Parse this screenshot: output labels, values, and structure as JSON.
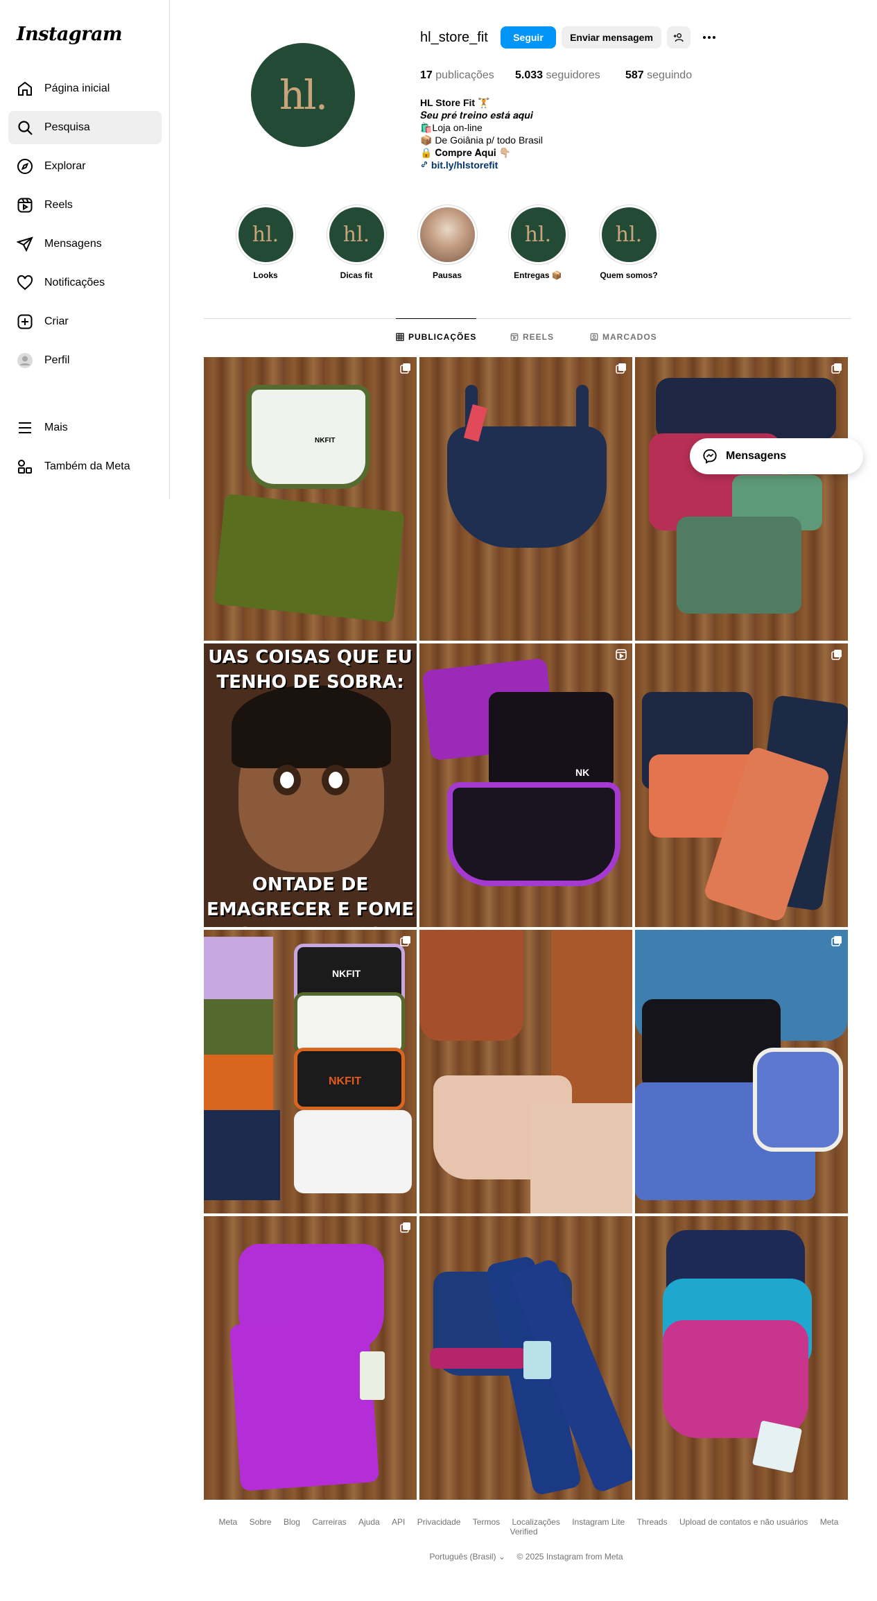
{
  "app": {
    "logo": "Instagram"
  },
  "sidebar": {
    "items": [
      {
        "label": "Página inicial",
        "icon": "home-icon"
      },
      {
        "label": "Pesquisa",
        "icon": "search-icon",
        "active": true
      },
      {
        "label": "Explorar",
        "icon": "compass-icon"
      },
      {
        "label": "Reels",
        "icon": "reels-icon"
      },
      {
        "label": "Mensagens",
        "icon": "send-icon"
      },
      {
        "label": "Notificações",
        "icon": "heart-icon"
      },
      {
        "label": "Criar",
        "icon": "plus-square-icon"
      },
      {
        "label": "Perfil",
        "icon": "profile-avatar-icon"
      },
      {
        "label": "Mais",
        "icon": "menu-icon"
      },
      {
        "label": "Também da Meta",
        "icon": "meta-apps-icon"
      }
    ]
  },
  "profile": {
    "avatar_text": "hl.",
    "username": "hl_store_fit",
    "follow_label": "Seguir",
    "message_label": "Enviar mensagem",
    "stats": {
      "posts_count": "17",
      "posts_label": "publicações",
      "followers_count": "5.033",
      "followers_label": "seguidores",
      "following_count": "587",
      "following_label": "seguindo"
    },
    "bio": {
      "name": "HL Store Fit 🏋️",
      "line1": "𝑺𝒆𝒖 𝒑𝒓𝒆́ 𝒕𝒓𝒆𝒊𝒏𝒐 𝒆𝒔𝒕𝒂́ 𝒂𝒒𝒖𝒊",
      "line2": "🛍️Loja on-line",
      "line3": "📦 De Goiânia p/ todo Brasil",
      "line4": "🔒 𝐂𝐨𝐦𝐩𝐫𝐞 𝐀𝐪𝐮𝐢 👇🏼",
      "link": "bit.ly/hlstorefit"
    }
  },
  "highlights": [
    {
      "label": "Looks",
      "thumb": "hl."
    },
    {
      "label": "Dicas fit",
      "thumb": "hl."
    },
    {
      "label": "Pausas",
      "thumb": ""
    },
    {
      "label": "Entregas 📦",
      "thumb": "hl."
    },
    {
      "label": "Quem somos?",
      "thumb": "hl."
    }
  ],
  "tabs": [
    {
      "label": "PUBLICAÇÕES",
      "icon": "grid-icon",
      "active": true
    },
    {
      "label": "REELS",
      "icon": "reels-icon"
    },
    {
      "label": "MARCADOS",
      "icon": "tagged-icon"
    }
  ],
  "posts": [
    {
      "desc": "white-green-set",
      "badge": "carousel-icon"
    },
    {
      "desc": "navy-bra",
      "badge": "carousel-icon"
    },
    {
      "desc": "green-pink-set",
      "badge": "carousel-icon"
    },
    {
      "desc": "meme",
      "badge": "",
      "meme_top": "UAS COISAS QUE EU TENHO DE SOBRA:",
      "meme_bottom": "ONTADE DE EMAGRECER E FOME O DIA INTEIRO"
    },
    {
      "desc": "purple-black-set",
      "badge": "reel-icon"
    },
    {
      "desc": "orange-navy-set",
      "badge": "carousel-icon"
    },
    {
      "desc": "multi-color-sets",
      "badge": "carousel-icon"
    },
    {
      "desc": "rust-beige-set",
      "badge": ""
    },
    {
      "desc": "blue-sets",
      "badge": "carousel-icon"
    },
    {
      "desc": "magenta-set",
      "badge": "carousel-icon"
    },
    {
      "desc": "navy-pink-set",
      "badge": ""
    },
    {
      "desc": "navy-cyan-pink-bras",
      "badge": ""
    }
  ],
  "brand_prints": {
    "nkfit": "NKFIT",
    "nk": "NK"
  },
  "messages_bar": {
    "label": "Mensagens"
  },
  "footer": {
    "links": [
      "Meta",
      "Sobre",
      "Blog",
      "Carreiras",
      "Ajuda",
      "API",
      "Privacidade",
      "Termos",
      "Localizações",
      "Instagram Lite",
      "Threads",
      "Upload de contatos e não usuários",
      "Meta Verified"
    ],
    "language": "Português (Brasil)",
    "copyright": "© 2025 Instagram from Meta"
  },
  "colors": {
    "accent": "#0095f6",
    "brand_green": "#234a35",
    "brand_gold": "#c7a47a"
  }
}
